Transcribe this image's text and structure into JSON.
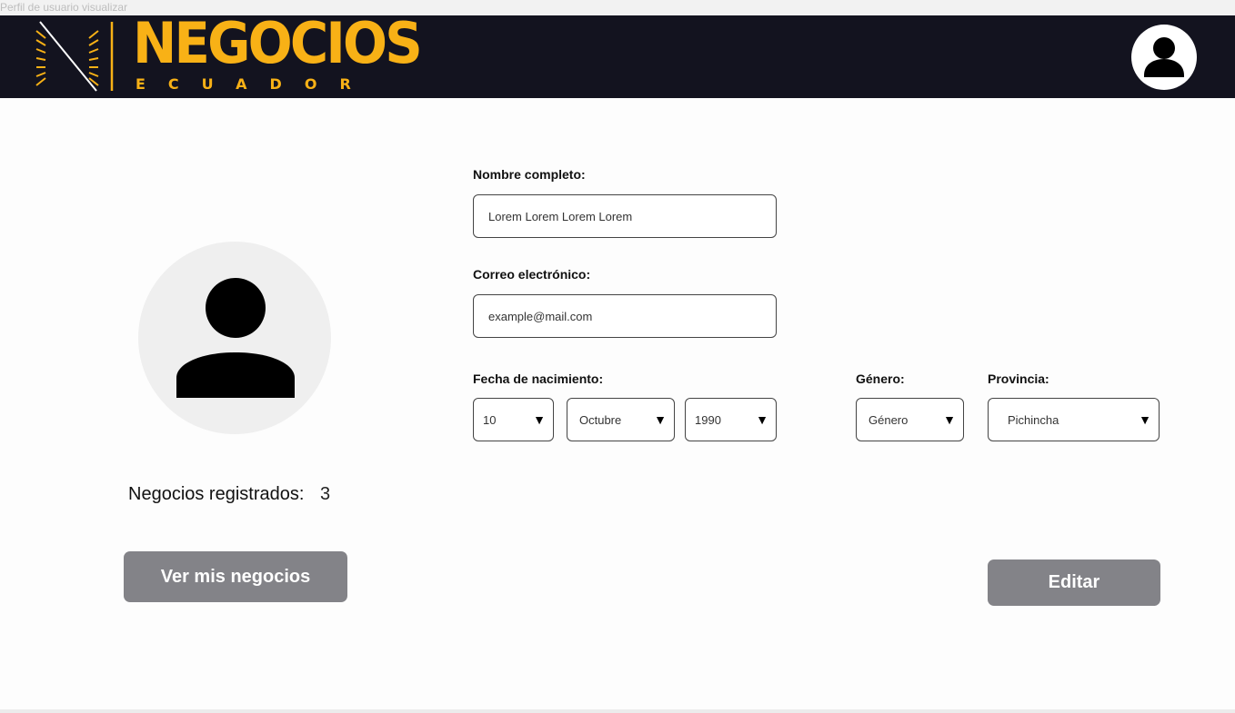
{
  "frame": {
    "label": "Perfil de usuario visualizar"
  },
  "header": {
    "brand": "NEGOCIOS",
    "brand_sub": "ECUADOR",
    "brand_color": "#f8b116",
    "background": "#13131f",
    "profile_icon": "user-icon"
  },
  "profile": {
    "avatar_icon": "user-icon",
    "count_label": "Negocios registrados:",
    "count_value": "3",
    "view_button": "Ver mis negocios"
  },
  "form": {
    "name_label": "Nombre completo:",
    "name_value": "Lorem Lorem Lorem Lorem",
    "email_label": "Correo electrónico:",
    "email_value": "example@mail.com",
    "birth_label": "Fecha de nacimiento:",
    "birth_day": "10",
    "birth_month": "Octubre",
    "birth_year": "1990",
    "gender_label": "Género:",
    "gender_value": "Género",
    "province_label": "Provincia:",
    "province_value": "Pichincha",
    "edit_button": "Editar"
  },
  "colors": {
    "button": "#838388",
    "avatar_bg": "#efefef"
  }
}
